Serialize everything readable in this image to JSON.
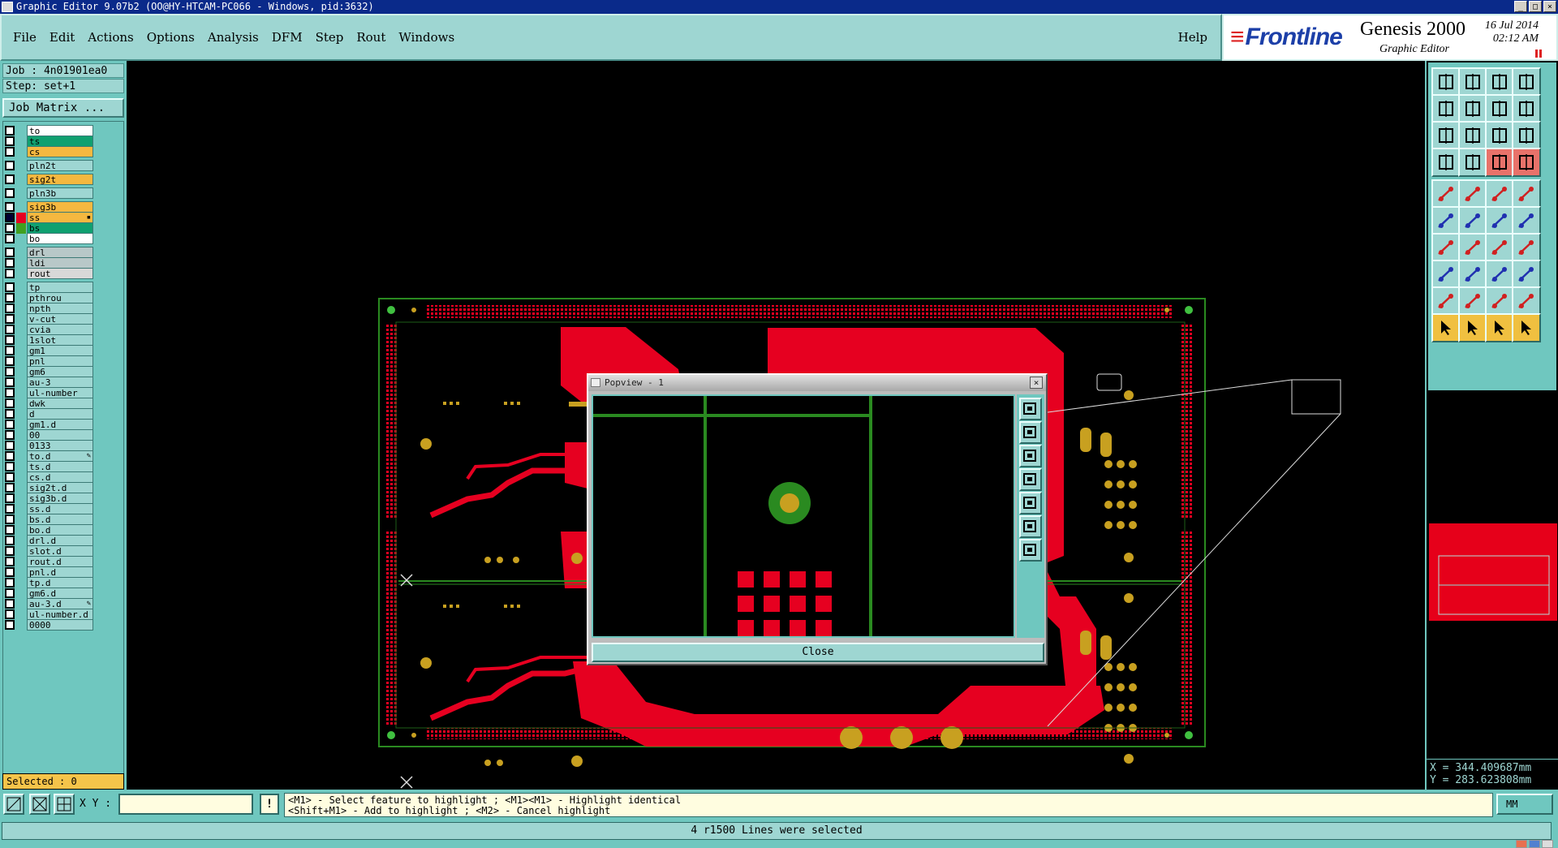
{
  "window": {
    "title": "Graphic Editor 9.07b2 (OO@HY-HTCAM-PC066 - Windows, pid:3632)",
    "buttons": [
      "_",
      "□",
      "×"
    ]
  },
  "menu": {
    "items": [
      "File",
      "Edit",
      "Actions",
      "Options",
      "Analysis",
      "DFM",
      "Step",
      "Rout",
      "Windows"
    ],
    "help": "Help"
  },
  "logo": {
    "brand": "Frontline",
    "product": "Genesis 2000",
    "subtitle": "Graphic Editor",
    "date": "16 Jul 2014",
    "time": "02:12 AM"
  },
  "job": {
    "job_line": "Job : 4n01901ea0",
    "step_line": "Step: set+1",
    "matrix_button": "Job Matrix ..."
  },
  "layers": [
    {
      "name": "to",
      "color": "#ffffff"
    },
    {
      "name": "ts",
      "color": "#10a070"
    },
    {
      "name": "cs",
      "color": "#f5b840"
    },
    {
      "name": "pln2t",
      "color": "#9ed6d2"
    },
    {
      "name": "sig2t",
      "color": "#f5b840"
    },
    {
      "name": "pln3b",
      "color": "#9ed6d2"
    },
    {
      "name": "sig3b",
      "color": "#f5b840"
    },
    {
      "name": "ss",
      "color": "#f5b840",
      "active": true,
      "swatch": "#e60020"
    },
    {
      "name": "bs",
      "color": "#10a070",
      "swatch": "#40a020"
    },
    {
      "name": "bo",
      "color": "#ffffff"
    },
    {
      "name": "drl",
      "color": "#b8c8c8"
    },
    {
      "name": "ldi",
      "color": "#b8c8c8"
    },
    {
      "name": "rout",
      "color": "#d8d8d8"
    },
    {
      "name": "tp",
      "color": "#9ed6d2"
    },
    {
      "name": "pthrou",
      "color": "#9ed6d2"
    },
    {
      "name": "npth",
      "color": "#9ed6d2"
    },
    {
      "name": "v-cut",
      "color": "#9ed6d2"
    },
    {
      "name": "cvia",
      "color": "#9ed6d2"
    },
    {
      "name": "1slot",
      "color": "#9ed6d2"
    },
    {
      "name": "gm1",
      "color": "#9ed6d2"
    },
    {
      "name": "pnl",
      "color": "#9ed6d2"
    },
    {
      "name": "gm6",
      "color": "#9ed6d2"
    },
    {
      "name": "au-3",
      "color": "#9ed6d2"
    },
    {
      "name": "ul-number",
      "color": "#9ed6d2"
    },
    {
      "name": "dwk",
      "color": "#9ed6d2"
    },
    {
      "name": "d",
      "color": "#9ed6d2"
    },
    {
      "name": "gm1.d",
      "color": "#9ed6d2"
    },
    {
      "name": "00",
      "color": "#9ed6d2"
    },
    {
      "name": "0133",
      "color": "#9ed6d2"
    },
    {
      "name": "to.d",
      "color": "#9ed6d2",
      "mark": "✎"
    },
    {
      "name": "ts.d",
      "color": "#9ed6d2"
    },
    {
      "name": "cs.d",
      "color": "#9ed6d2"
    },
    {
      "name": "sig2t.d",
      "color": "#9ed6d2"
    },
    {
      "name": "sig3b.d",
      "color": "#9ed6d2"
    },
    {
      "name": "ss.d",
      "color": "#9ed6d2"
    },
    {
      "name": "bs.d",
      "color": "#9ed6d2"
    },
    {
      "name": "bo.d",
      "color": "#9ed6d2"
    },
    {
      "name": "drl.d",
      "color": "#9ed6d2"
    },
    {
      "name": "slot.d",
      "color": "#9ed6d2"
    },
    {
      "name": "rout.d",
      "color": "#9ed6d2"
    },
    {
      "name": "pnl.d",
      "color": "#9ed6d2"
    },
    {
      "name": "tp.d",
      "color": "#9ed6d2"
    },
    {
      "name": "gm6.d",
      "color": "#9ed6d2"
    },
    {
      "name": "au-3.d",
      "color": "#9ed6d2",
      "mark": "✎"
    },
    {
      "name": "ul-number.d",
      "color": "#9ed6d2"
    },
    {
      "name": "0000",
      "color": "#9ed6d2"
    }
  ],
  "selected_count": "Selected : 0",
  "coords": {
    "x": "X = 344.409687mm",
    "y": "Y = 283.623808mm"
  },
  "bottom": {
    "xy_label": "X Y :",
    "xy_value": "",
    "info_label": "!",
    "hint_line1": "<M1> - Select feature to highlight ; <M1><M1> - Highlight identical",
    "hint_line2": "<Shift+M1> - Add to highlight ; <M2> - Cancel highlight",
    "unit": "MM",
    "status": "4 r1500 Lines were selected"
  },
  "popview": {
    "title": "Popview - 1",
    "close_label": "Close",
    "close_x": "×"
  },
  "colors": {
    "board_red": "#e60020",
    "pad_gold": "#c8a020",
    "trace_green": "#2a8a20",
    "panel_teal": "#6fc7bf"
  }
}
